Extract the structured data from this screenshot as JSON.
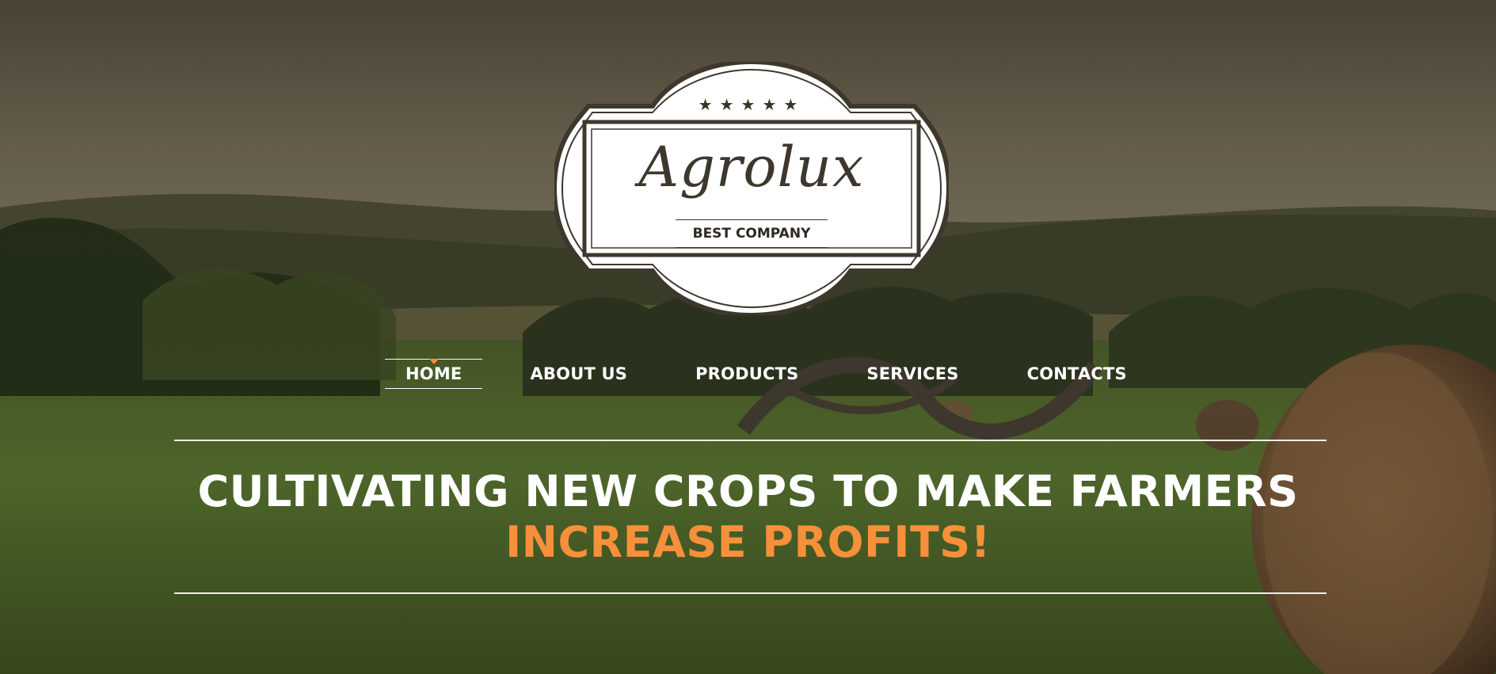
{
  "logo": {
    "stars": "★★★★★",
    "name": "Agrolux",
    "tagline": "BEST COMPANY"
  },
  "nav": {
    "items": [
      {
        "label": "HOME",
        "active": true
      },
      {
        "label": "ABOUT US",
        "active": false
      },
      {
        "label": "PRODUCTS",
        "active": false
      },
      {
        "label": "SERVICES",
        "active": false
      },
      {
        "label": "CONTACTS",
        "active": false
      }
    ]
  },
  "hero": {
    "headline_line1": "CULTIVATING NEW CROPS TO MAKE FARMERS",
    "headline_line2": "INCREASE PROFITS!"
  },
  "colors": {
    "accent": "#f7903a",
    "text": "#ffffff",
    "logo_ink": "#3e372d"
  }
}
